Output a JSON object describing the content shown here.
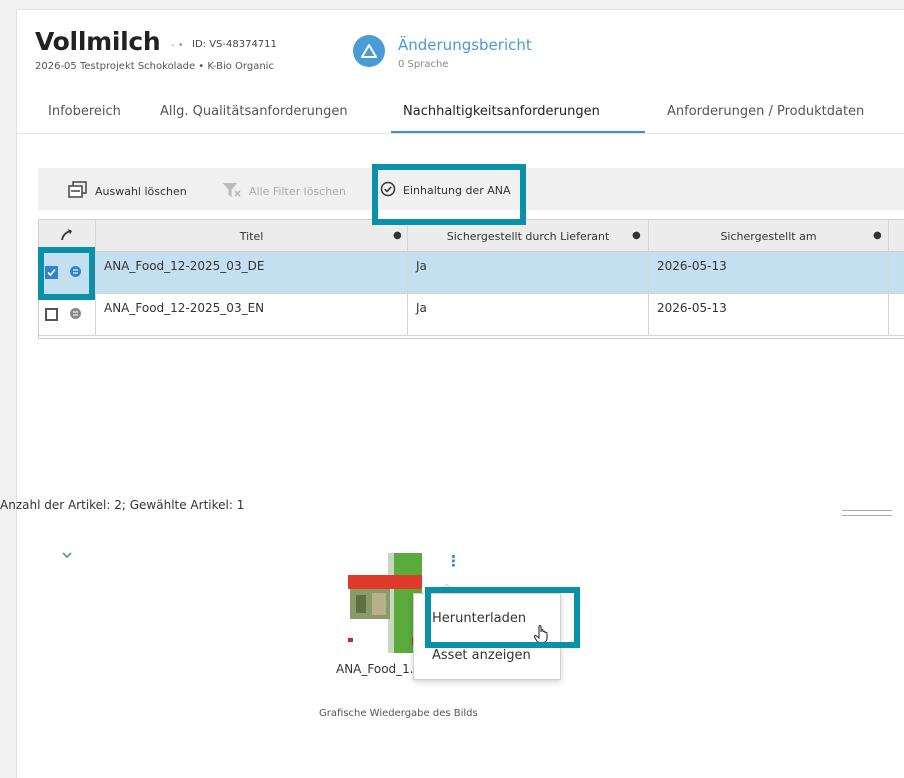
{
  "header": {
    "title": "Vollmilch",
    "separator": "- •",
    "id": "ID: VS-48374711",
    "subtitle": "2026-05 Testprojekt Schokolade • K-Bio Organic"
  },
  "change_report": {
    "title": "Änderungsbericht",
    "subtitle": "0 Sprache"
  },
  "tabs": [
    {
      "label": "Infobereich"
    },
    {
      "label": "Allg. Qualitätsanforderungen"
    },
    {
      "label": "Nachhaltigkeitsanforderungen",
      "active": true
    },
    {
      "label": "Anforderungen / Produktdaten"
    }
  ],
  "toolbar": {
    "clear_selection": "Auswahl löschen",
    "clear_filters": "Alle Filter löschen",
    "compliance": "Einhaltung der ANA"
  },
  "grid": {
    "columns": [
      "Titel",
      "Sichergestellt durch Lieferant",
      "Sichergestellt am"
    ],
    "rows": [
      {
        "title": "ANA_Food_12-2025_03_DE",
        "supplier": "Ja",
        "date": "2026-05-13",
        "selected": true
      },
      {
        "title": "ANA_Food_12-2025_03_EN",
        "supplier": "Ja",
        "date": "2026-05-13",
        "selected": false
      }
    ]
  },
  "status": {
    "count_text": "Anzahl der Artikel: 2; Gewählte Artikel: 1"
  },
  "asset": {
    "name": "ANA_Food_1...",
    "caption": "Grafische Wiedergabe des Bilds"
  },
  "context_menu": {
    "items": [
      "Herunterladen",
      "Asset anzeigen"
    ]
  },
  "colors": {
    "accent": "#4a9bd6",
    "highlight": "#0a91a8",
    "selected_row": "#c3dff0",
    "tab_underline": "#3d8fd0"
  },
  "icons": [
    "change-report-icon",
    "clear-selection-icon",
    "clear-filter-icon",
    "check-circle-icon",
    "pin-icon",
    "kebab-menu-icon",
    "chevron-down-icon",
    "hand-cursor-icon"
  ]
}
